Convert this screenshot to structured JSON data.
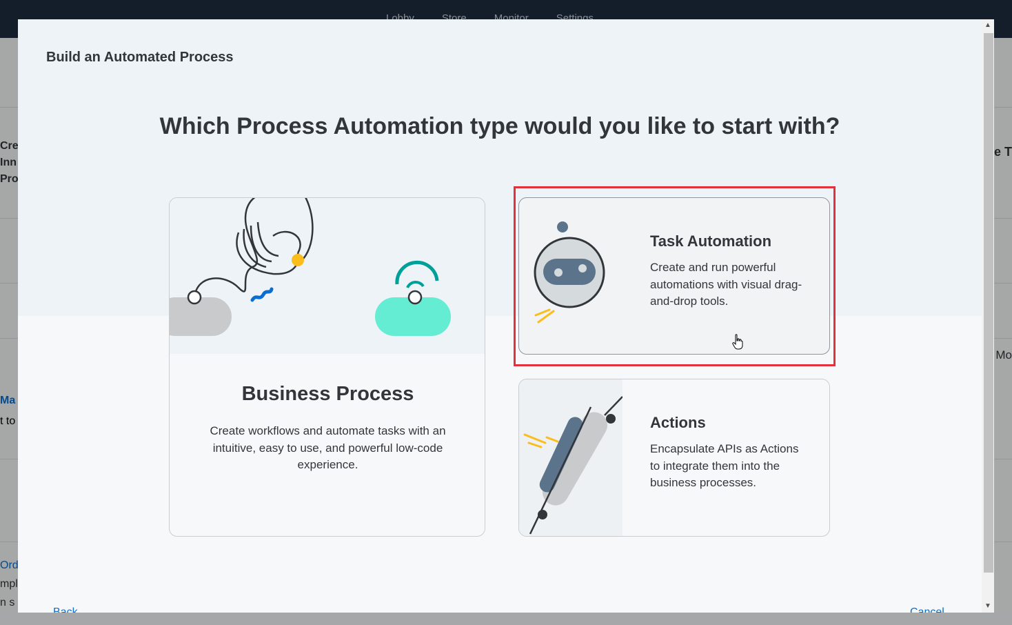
{
  "background": {
    "nav_items": [
      "Lobby",
      "Store",
      "Monitor",
      "Settings"
    ],
    "left_fragments": [
      "Cre",
      "Inn",
      "Pro"
    ],
    "left_link": "Ma",
    "left_text": "t to",
    "left_link2": "Orde",
    "left_text2": "mple",
    "left_text3": "n s",
    "right_fragment": "e T",
    "right_fragment2": "Mo"
  },
  "dialog": {
    "title": "Build an Automated Process",
    "question": "Which Process Automation type would you like to start with?",
    "cards": {
      "business_process": {
        "title": "Business Process",
        "description": "Create workflows and automate tasks with an intuitive, easy to use, and powerful low-code experience."
      },
      "task_automation": {
        "title": "Task Automation",
        "description": "Create and run powerful automations with visual drag-and-drop tools."
      },
      "actions": {
        "title": "Actions",
        "description": "Encapsulate APIs as Actions to integrate them into the business processes."
      }
    },
    "footer": {
      "back_label": "Back",
      "cancel_label": "Cancel"
    }
  },
  "colors": {
    "highlight": "#e2313a",
    "accent_link": "#0a6ed1",
    "shell": "#1d2d3e",
    "teal": "#64edd2",
    "yellow": "#fbbd1c"
  }
}
